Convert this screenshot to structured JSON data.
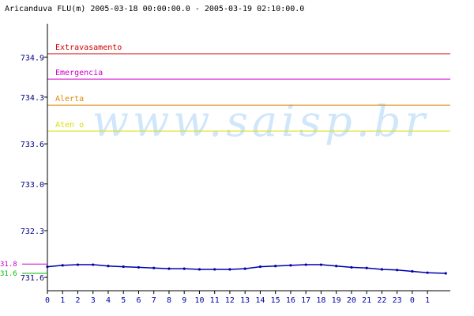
{
  "chart_data": {
    "type": "line",
    "title": "Aricanduva FLU(m) 2005-03-18 00:00:00.0 - 2005-03-19 02:10:00.0",
    "watermark": "www.saisp.br",
    "xlabel": "",
    "ylabel": "",
    "x_unit": "hour of day",
    "xlim": [
      0,
      26.5
    ],
    "ylim": [
      731.4,
      735.4
    ],
    "x_ticks": [
      "0",
      "1",
      "2",
      "3",
      "4",
      "5",
      "6",
      "7",
      "8",
      "9",
      "10",
      "11",
      "12",
      "13",
      "14",
      "15",
      "16",
      "17",
      "18",
      "19",
      "20",
      "21",
      "22",
      "23",
      "0",
      "1"
    ],
    "y_ticks": [
      {
        "value": 731.6,
        "label": "731.6"
      },
      {
        "value": 732.3,
        "label": "732.3"
      },
      {
        "value": 733.0,
        "label": "733.0"
      },
      {
        "value": 733.6,
        "label": "733.6"
      },
      {
        "value": 734.3,
        "label": "734.3"
      },
      {
        "value": 734.9,
        "label": "734.9"
      }
    ],
    "thresholds": [
      {
        "name": "Extravasamento",
        "value": 734.95,
        "color": "#cc0000"
      },
      {
        "name": "Emergencia",
        "value": 734.57,
        "color": "#cc00cc"
      },
      {
        "name": "Alerta",
        "value": 734.18,
        "color": "#dd8800"
      },
      {
        "name": "Aten  o",
        "value": 733.79,
        "color": "#dddd00"
      }
    ],
    "markers": [
      {
        "label": "31.8",
        "value": 731.8,
        "color": "#cc00cc"
      },
      {
        "label": "31.6",
        "value": 731.66,
        "color": "#00bb00"
      }
    ],
    "series": [
      {
        "color": "#0000aa",
        "x": [
          0,
          1,
          2,
          3,
          4,
          5,
          6,
          7,
          8,
          9,
          10,
          11,
          12,
          13,
          14,
          15,
          16,
          17,
          18,
          19,
          20,
          21,
          22,
          23,
          24,
          25,
          26.2
        ],
        "y": [
          731.76,
          731.78,
          731.79,
          731.79,
          731.77,
          731.76,
          731.75,
          731.74,
          731.73,
          731.73,
          731.72,
          731.72,
          731.72,
          731.73,
          731.76,
          731.77,
          731.78,
          731.79,
          731.79,
          731.77,
          731.75,
          731.74,
          731.72,
          731.71,
          731.69,
          731.67,
          731.66
        ]
      }
    ]
  }
}
